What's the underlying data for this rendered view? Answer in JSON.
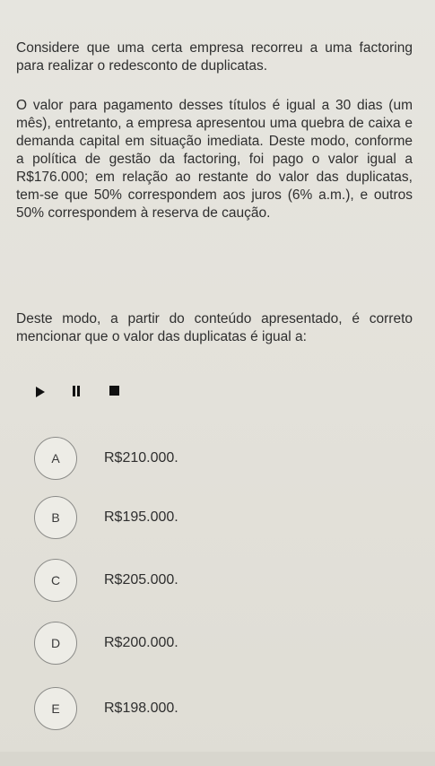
{
  "question": {
    "paragraph1": "Considere que uma certa empresa recorreu a uma factoring para realizar o redesconto de duplicatas.",
    "paragraph2": "O valor para pagamento desses títulos é igual a 30 dias (um mês), entretanto, a empresa apresentou uma quebra de caixa e demanda capital em situação imediata. Deste modo, conforme a política de gestão da factoring, foi pago o valor igual a R$176.000; em relação ao restante do valor das duplicatas, tem-se que 50% correspondem aos juros (6% a.m.), e outros 50% correspondem à reserva de caução.",
    "paragraph3": "Deste modo, a partir do conteúdo apresentado, é correto mencionar que o valor das duplicatas é igual a:"
  },
  "media_controls": {
    "play_icon": "play-icon",
    "pause_icon": "pause-icon",
    "stop_icon": "stop-icon"
  },
  "options": [
    {
      "letter": "A",
      "value": "R$210.000."
    },
    {
      "letter": "B",
      "value": "R$195.000."
    },
    {
      "letter": "C",
      "value": "R$205.000."
    },
    {
      "letter": "D",
      "value": "R$200.000."
    },
    {
      "letter": "E",
      "value": "R$198.000."
    }
  ]
}
